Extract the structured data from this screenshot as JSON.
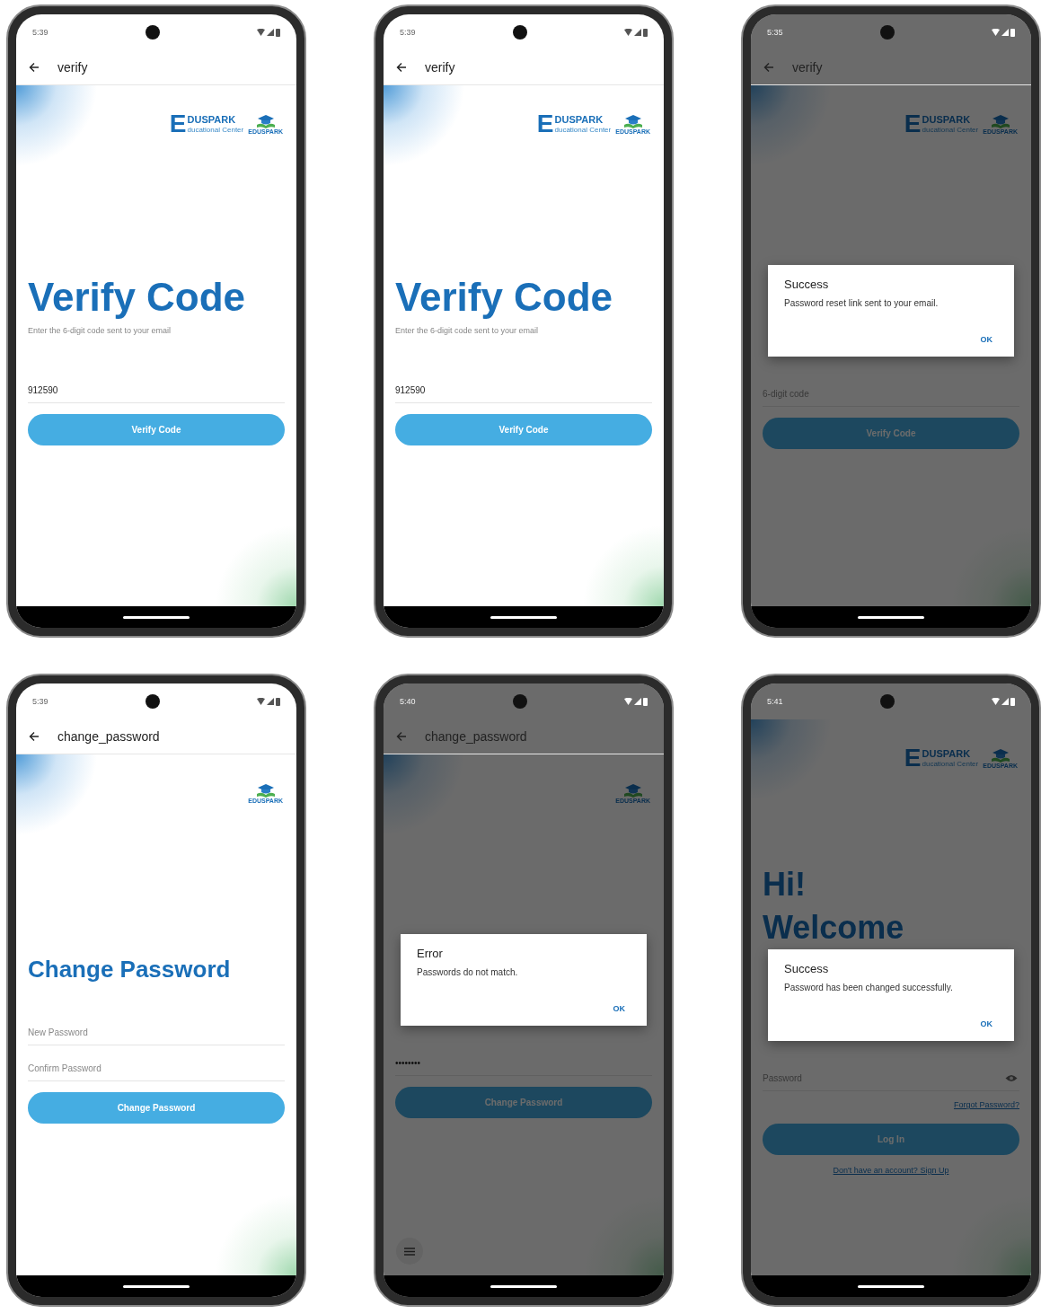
{
  "phones": [
    {
      "time": "5:39",
      "dimmed": false,
      "app_bar": {
        "title": "verify"
      },
      "logo": {
        "kind": "wordmark",
        "letter": "E",
        "name": "DUSPARK",
        "tagline": "ducational Center",
        "emblem_caption": "EDUSPARK"
      },
      "floating_menu": false,
      "blocks": [
        {
          "kind": "display",
          "text": "Verify Code"
        },
        {
          "kind": "subtitle",
          "text": "Enter the 6-digit code sent to your email"
        },
        {
          "kind": "field",
          "value": "912590"
        },
        {
          "kind": "button",
          "label": "Verify Code"
        }
      ]
    },
    {
      "time": "5:39",
      "dimmed": false,
      "app_bar": {
        "title": "verify"
      },
      "logo": {
        "kind": "wordmark",
        "letter": "E",
        "name": "DUSPARK",
        "tagline": "ducational Center",
        "emblem_caption": "EDUSPARK"
      },
      "floating_menu": false,
      "blocks": [
        {
          "kind": "display",
          "text": "Verify Code"
        },
        {
          "kind": "subtitle",
          "text": "Enter the 6-digit code sent to your email"
        },
        {
          "kind": "field",
          "value": "912590"
        },
        {
          "kind": "button",
          "label": "Verify Code"
        }
      ]
    },
    {
      "time": "5:35",
      "dimmed": true,
      "app_bar": {
        "title": "verify"
      },
      "logo": {
        "kind": "wordmark",
        "letter": "E",
        "name": "DUSPARK",
        "tagline": "ducational Center",
        "emblem_caption": "EDUSPARK"
      },
      "floating_menu": false,
      "blocks": [
        {
          "kind": "dialog",
          "title": "Success",
          "message": "Password reset link sent to your email.",
          "action": "OK"
        },
        {
          "kind": "field",
          "placeholder": "6-digit code"
        },
        {
          "kind": "button",
          "label": "Verify Code"
        }
      ]
    },
    {
      "time": "5:39",
      "dimmed": false,
      "app_bar": {
        "title": "change_password"
      },
      "logo": {
        "kind": "emblem",
        "emblem_caption": "EDUSPARK"
      },
      "floating_menu": false,
      "blocks": [
        {
          "kind": "heading",
          "text": "Change Password"
        },
        {
          "kind": "field",
          "placeholder": "New Password"
        },
        {
          "kind": "field",
          "placeholder": "Confirm Password"
        },
        {
          "kind": "button",
          "label": "Change Password"
        }
      ]
    },
    {
      "time": "5:40",
      "dimmed": true,
      "app_bar": {
        "title": "change_password"
      },
      "logo": {
        "kind": "emblem",
        "emblem_caption": "EDUSPARK"
      },
      "floating_menu": true,
      "blocks": [
        {
          "kind": "dialog",
          "title": "Error",
          "message": "Passwords do not match.",
          "action": "OK"
        },
        {
          "kind": "field",
          "value": "••••••••"
        },
        {
          "kind": "button",
          "label": "Change Password"
        }
      ]
    },
    {
      "time": "5:41",
      "dimmed": true,
      "logo": {
        "kind": "wordmark",
        "letter": "E",
        "name": "DUSPARK",
        "tagline": "ducational Center",
        "emblem_caption": "EDUSPARK"
      },
      "floating_menu": false,
      "blocks": [
        {
          "kind": "greeting",
          "text": "Hi!"
        },
        {
          "kind": "greeting",
          "text": "Welcome"
        },
        {
          "kind": "dialog",
          "title": "Success",
          "message": "Password has been changed successfully.",
          "action": "OK"
        },
        {
          "kind": "password",
          "placeholder": "Password"
        },
        {
          "kind": "link_right",
          "text": "Forgot Password?"
        },
        {
          "kind": "button",
          "label": "Log In"
        },
        {
          "kind": "link_center",
          "text": "Don't have an account? Sign Up"
        }
      ]
    }
  ]
}
